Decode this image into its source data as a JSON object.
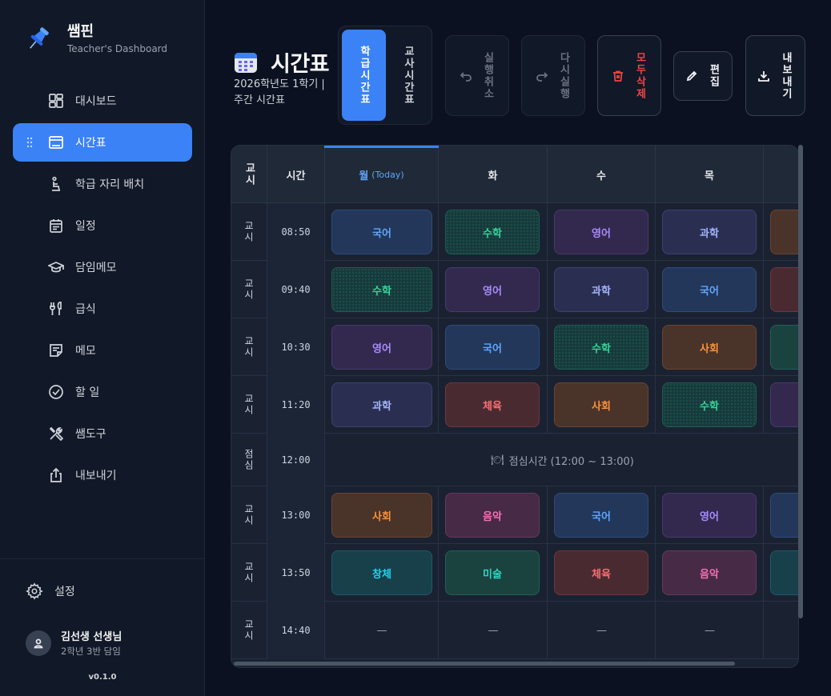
{
  "brand": {
    "name": "쌤핀",
    "subtitle": "Teacher's Dashboard"
  },
  "nav": [
    {
      "label": "대시보드",
      "icon": "dashboard-icon",
      "active": false
    },
    {
      "label": "시간표",
      "icon": "timetable-icon",
      "active": true
    },
    {
      "label": "학급 자리 배치",
      "icon": "seat-icon",
      "active": false
    },
    {
      "label": "일정",
      "icon": "calendar-icon",
      "active": false
    },
    {
      "label": "담임메모",
      "icon": "graduation-cap-icon",
      "active": false
    },
    {
      "label": "급식",
      "icon": "utensils-icon",
      "active": false
    },
    {
      "label": "메모",
      "icon": "note-icon",
      "active": false
    },
    {
      "label": "할 일",
      "icon": "check-circle-icon",
      "active": false
    },
    {
      "label": "쌤도구",
      "icon": "tools-icon",
      "active": false
    },
    {
      "label": "내보내기",
      "icon": "share-icon",
      "active": false
    }
  ],
  "settings_label": "설정",
  "user": {
    "name": "김선생 선생님",
    "role": "2학년 3반 담임"
  },
  "version": "v0.1.0",
  "page": {
    "title": "시간표",
    "subtitle": "2026학년도 1학기 | 주간 시간표"
  },
  "view_toggle": {
    "class_label": "학급시간표",
    "teacher_label": "교사시간표",
    "selected": "class"
  },
  "toolbar": {
    "undo_label": "실행취소",
    "redo_label": "다시실행",
    "delete_all_label": "모두삭제",
    "edit_label": "편집",
    "export_label": "내보내기"
  },
  "colors": {
    "accent": "#3b82f6",
    "danger": "#ef4444",
    "background": "#0b1120"
  },
  "table": {
    "header": {
      "period": "교시",
      "time": "시간",
      "today_tag": "(Today)"
    },
    "days": [
      "월",
      "화",
      "수",
      "목"
    ],
    "rows": [
      {
        "period": "교시",
        "time": "08:50",
        "cells": [
          "국어",
          "수학",
          "영어",
          "과학"
        ]
      },
      {
        "period": "교시",
        "time": "09:40",
        "cells": [
          "수학",
          "영어",
          "과학",
          "국어"
        ]
      },
      {
        "period": "교시",
        "time": "10:30",
        "cells": [
          "영어",
          "국어",
          "수학",
          "사회"
        ]
      },
      {
        "period": "교시",
        "time": "11:20",
        "cells": [
          "과학",
          "체육",
          "사회",
          "수학"
        ]
      },
      {
        "period": "점심",
        "time": "12:00",
        "lunch": "점심시간 (12:00 ~ 13:00)"
      },
      {
        "period": "교시",
        "time": "13:00",
        "cells": [
          "사회",
          "음악",
          "국어",
          "영어"
        ]
      },
      {
        "period": "교시",
        "time": "13:50",
        "cells": [
          "창체",
          "미술",
          "체육",
          "음악"
        ]
      },
      {
        "period": "교시",
        "time": "14:40",
        "cells": [
          "—",
          "—",
          "—",
          "—"
        ]
      }
    ]
  }
}
